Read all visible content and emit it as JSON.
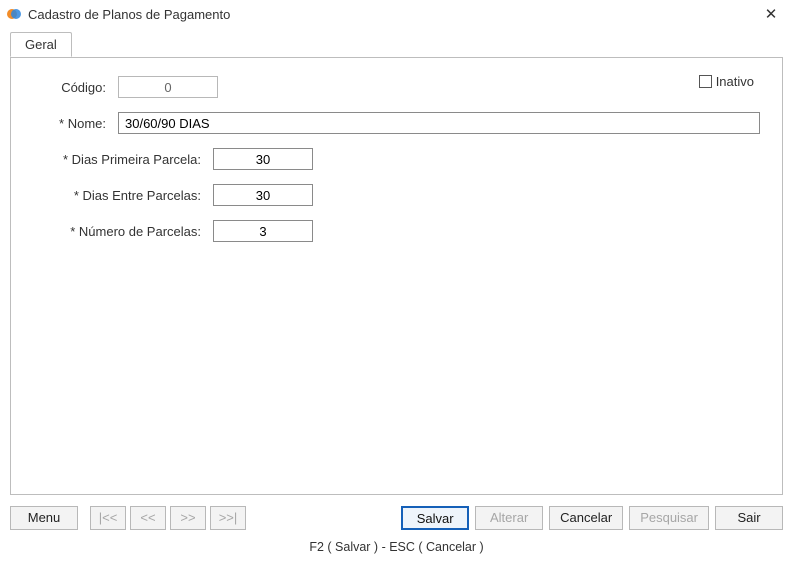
{
  "window": {
    "title": "Cadastro de Planos de Pagamento"
  },
  "tabs": {
    "geral": "Geral"
  },
  "fields": {
    "codigo_label": "Código:",
    "codigo_value": "0",
    "nome_label": "* Nome:",
    "nome_value": "30/60/90 DIAS",
    "dias_primeira_label": "* Dias Primeira Parcela:",
    "dias_primeira_value": "30",
    "dias_entre_label": "* Dias Entre Parcelas:",
    "dias_entre_value": "30",
    "numero_parcelas_label": "* Número de Parcelas:",
    "numero_parcelas_value": "3",
    "inativo_label": "Inativo"
  },
  "buttons": {
    "menu": "Menu",
    "nav_first": "|<<",
    "nav_prev": "<<",
    "nav_next": ">>",
    "nav_last": ">>|",
    "salvar": "Salvar",
    "alterar": "Alterar",
    "cancelar": "Cancelar",
    "pesquisar": "Pesquisar",
    "sair": "Sair"
  },
  "status": "F2 ( Salvar )  -  ESC ( Cancelar )"
}
